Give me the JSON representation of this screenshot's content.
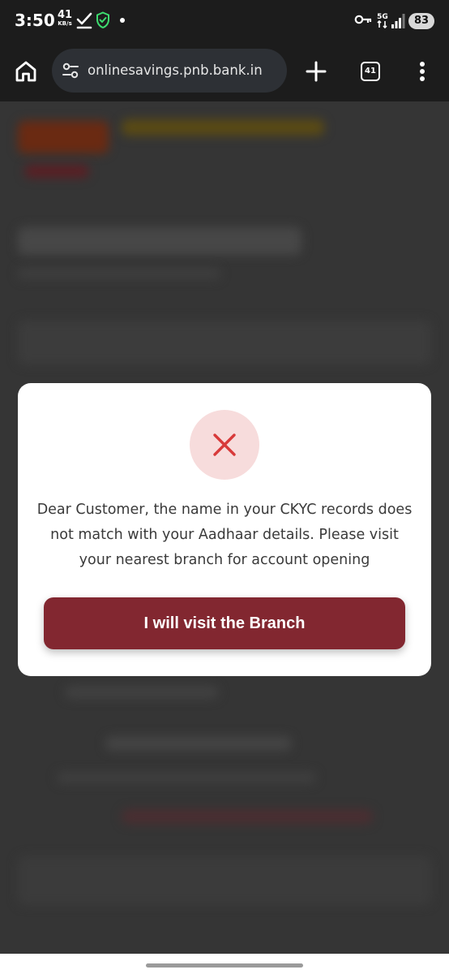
{
  "status_bar": {
    "time": "3:50",
    "net_speed_value": "41",
    "net_speed_unit": "KB/s",
    "battery_level": "83",
    "icons": [
      "download-done-icon",
      "shield-check-icon",
      "notification-dot-icon",
      "vpn-key-icon",
      "5g-data-icon",
      "signal-strength-icon",
      "battery-icon"
    ]
  },
  "browser": {
    "url": "onlinesavings.pnb.bank.in",
    "tab_count": "41",
    "icons": [
      "home-icon",
      "site-settings-icon",
      "new-tab-plus-icon",
      "tab-switcher-icon",
      "more-vert-icon"
    ]
  },
  "modal": {
    "icon": "error-x-icon",
    "message": "Dear Customer, the name in your CKYC records does not match with your Aadhaar details. Please visit your nearest branch for account opening",
    "button_label": "I will visit the Branch"
  },
  "colors": {
    "accent_button": "#822730",
    "error_icon": "#d83a3a",
    "error_circle_bg": "#f7dcdc",
    "toolbar_bg": "#1c1c1c"
  }
}
